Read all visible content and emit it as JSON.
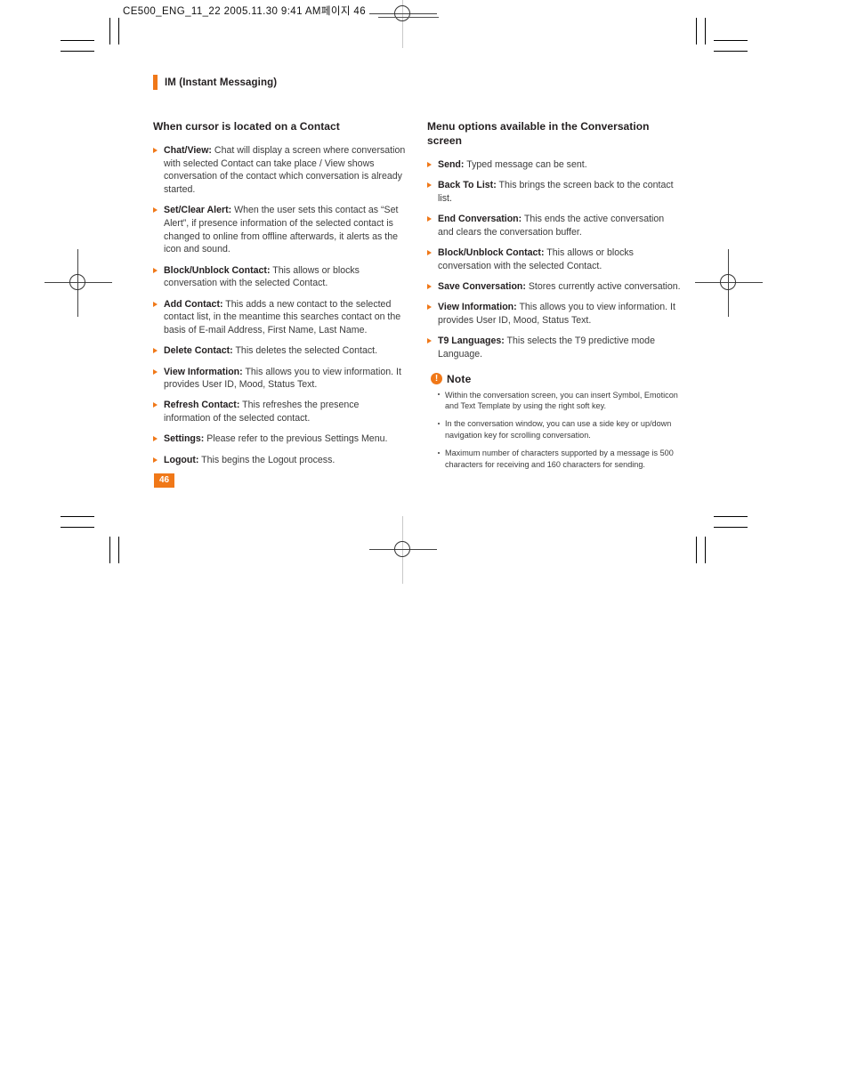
{
  "slug": {
    "text": "CE500_ENG_11_22  2005.11.30 9:41 AM페이지 46"
  },
  "running_head": {
    "title": "IM (Instant Messaging)"
  },
  "colors": {
    "accent": "#f07818",
    "body_text": "#3b3b3b",
    "heading_text": "#231f20"
  },
  "left_column": {
    "title": "When cursor is located on a Contact",
    "items": [
      {
        "label": "Chat/View:",
        "text": " Chat will display a screen where conversation with selected Contact can take place / View shows conversation of the contact which conversation is already started."
      },
      {
        "label": "Set/Clear Alert:",
        "text": " When the user sets this contact as “Set Alert”, if presence information of the selected contact is changed to online from offline afterwards, it alerts as the icon and sound."
      },
      {
        "label": "Block/Unblock Contact:",
        "text": " This allows or blocks conversation with the selected Contact."
      },
      {
        "label": "Add Contact:",
        "text": " This adds a new contact to the selected contact list, in the meantime this searches contact on the basis of E-mail Address, First Name, Last Name."
      },
      {
        "label": "Delete Contact:",
        "text": " This deletes the selected Contact."
      },
      {
        "label": "View Information:",
        "text": " This allows you to view information. It provides User ID, Mood, Status Text."
      },
      {
        "label": "Refresh Contact:",
        "text": " This refreshes the presence information of the selected contact."
      },
      {
        "label": "Settings:",
        "text": " Please refer to the previous Settings Menu."
      },
      {
        "label": "Logout:",
        "text": " This begins the Logout process."
      }
    ]
  },
  "right_column": {
    "title": "Menu options available in the Conversation screen",
    "items": [
      {
        "label": "Send:",
        "text": " Typed message can be sent."
      },
      {
        "label": "Back To List:",
        "text": " This brings the screen back to the contact list."
      },
      {
        "label": "End Conversation:",
        "text": " This ends the active conversation and clears the conversation buffer."
      },
      {
        "label": "Block/Unblock Contact:",
        "text": " This allows or blocks conversation with the selected Contact."
      },
      {
        "label": "Save Conversation:",
        "text": " Stores currently active conversation."
      },
      {
        "label": "View Information:",
        "text": " This allows you to view information. It provides User ID, Mood, Status Text."
      },
      {
        "label": "T9 Languages:",
        "text": " This selects the T9 predictive mode Language."
      }
    ],
    "note": {
      "icon": "exclamation-icon",
      "title": "Note",
      "items": [
        "Within the conversation screen, you can insert Symbol, Emoticon and Text Template by using the right soft key.",
        "In the conversation window, you can use a side key or up/down navigation key for scrolling conversation.",
        "Maximum number of characters supported by a message is 500 characters for receiving and 160 characters for sending."
      ]
    }
  },
  "folio": {
    "page_number": "46"
  }
}
